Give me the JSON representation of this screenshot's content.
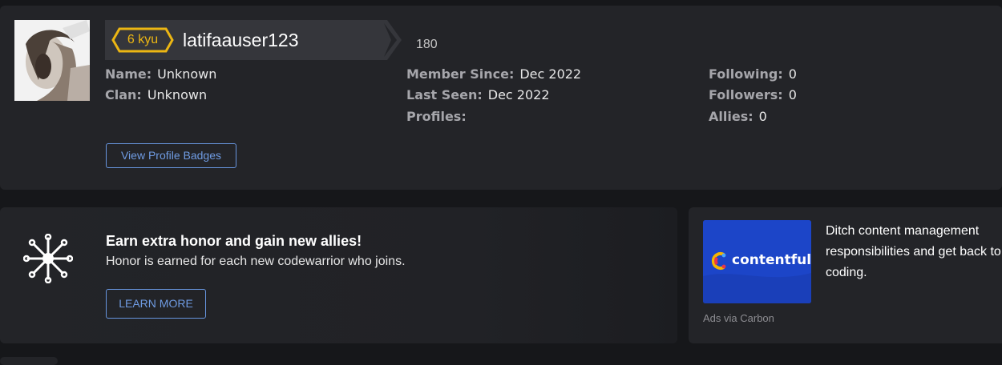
{
  "profile": {
    "rank": "6 kyu",
    "username": "latifaauser123",
    "honor": "180",
    "name_label": "Name:",
    "name_value": "Unknown",
    "clan_label": "Clan:",
    "clan_value": "Unknown",
    "member_since_label": "Member Since:",
    "member_since_value": "Dec 2022",
    "last_seen_label": "Last Seen:",
    "last_seen_value": "Dec 2022",
    "profiles_label": "Profiles:",
    "following_label": "Following:",
    "following_value": "0",
    "followers_label": "Followers:",
    "followers_value": "0",
    "allies_label": "Allies:",
    "allies_value": "0",
    "badges_button": "View Profile Badges",
    "rank_color": "#ecb613"
  },
  "invite": {
    "icon": "network-icon",
    "title": "Earn extra honor and gain new allies!",
    "description": "Honor is earned for each new codewarrior who joins.",
    "button": "LEARN MORE"
  },
  "ad": {
    "logo_text": "contentful",
    "text": "Ditch content management responsibilities and get back to coding.",
    "via": "Ads via Carbon",
    "brand_color": "#1c45c8"
  }
}
